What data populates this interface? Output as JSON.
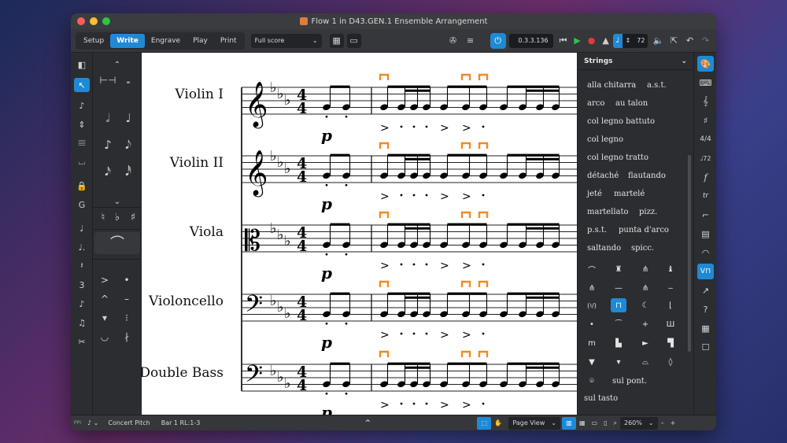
{
  "window": {
    "title": "Flow 1 in D43.GEN.1 Ensemble Arrangement"
  },
  "toolbar": {
    "modes": [
      "Setup",
      "Write",
      "Engrave",
      "Play",
      "Print"
    ],
    "active_mode": "Write",
    "layout": "Full score",
    "position": "0.3.3.136",
    "tempo": "72"
  },
  "score": {
    "instruments": [
      "Violin I",
      "Violin II",
      "Viola",
      "Violoncello",
      "Double Bass"
    ],
    "dynamic": "p"
  },
  "panel": {
    "title": "Strings",
    "techniques": [
      [
        "alla chitarra",
        "a.s.t."
      ],
      [
        "arco",
        "au talon"
      ],
      [
        "col legno battuto"
      ],
      [
        "col legno"
      ],
      [
        "col legno tratto"
      ],
      [
        "détaché",
        "flautando"
      ],
      [
        "jeté",
        "martelé"
      ],
      [
        "martellato",
        "pizz."
      ],
      [
        "p.s.t.",
        "punta d'arco"
      ],
      [
        "saltando",
        "spicc."
      ]
    ],
    "sul_pont": "sul pont.",
    "sul_tasto": "sul tasto"
  },
  "status": {
    "pitch": "Concert Pitch",
    "selection": "Bar 1 RL:1-3",
    "view": "Page View",
    "zoom": "260%"
  },
  "colors": {
    "accent": "#1e8ad6",
    "bracket": "#f08a24"
  }
}
